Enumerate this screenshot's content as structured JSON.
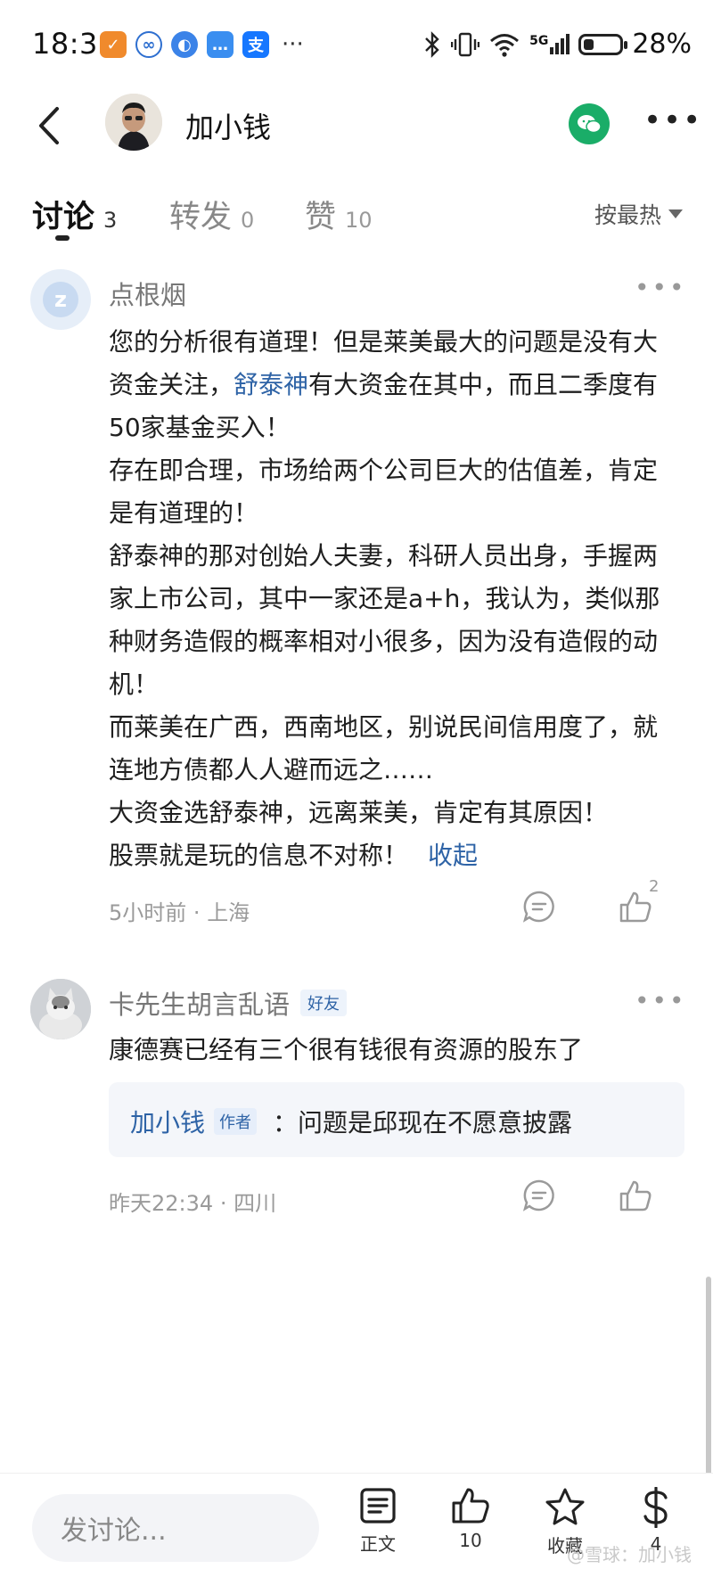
{
  "status_bar": {
    "time": "18:31",
    "network": "5G",
    "battery": "28%",
    "battery_level": 0.28
  },
  "header": {
    "title": "加小钱"
  },
  "tabs": [
    {
      "label": "讨论",
      "count": "3",
      "active": true
    },
    {
      "label": "转发",
      "count": "0",
      "active": false
    },
    {
      "label": "赞",
      "count": "10",
      "active": false
    }
  ],
  "sort": {
    "label": "按最热"
  },
  "comments": [
    {
      "user": "点根烟",
      "text_parts": {
        "p1_a": "您的分析很有道理！但是莱美最大的问题是没有大资金关注，",
        "p1_link": "舒泰神",
        "p1_b": "有大资金在其中，而且二季度有50家基金买入！",
        "p2": "存在即合理，市场给两个公司巨大的估值差，肯定是有道理的！",
        "p3": "舒泰神的那对创始人夫妻，科研人员出身，手握两家上市公司，其中一家还是a+h，我认为，类似那种财务造假的概率相对小很多，因为没有造假的动机！",
        "p4": "而莱美在广西，西南地区，别说民间信用度了，就连地方债都人人避而远之……",
        "p5": "大资金选舒泰神，远离莱美，肯定有其原因！",
        "p6": "股票就是玩的信息不对称！"
      },
      "collapse_label": "收起",
      "time": "5小时前",
      "location": "上海",
      "likes": "2"
    },
    {
      "user": "卡先生胡言乱语",
      "badge": "好友",
      "text": "康德赛已经有三个很有钱很有资源的股东了",
      "reply": {
        "name": "加小钱",
        "tag": "作者",
        "text": "：问题是邱现在不愿意披露"
      },
      "time": "昨天22:34",
      "location": "四川"
    }
  ],
  "bottom_bar": {
    "input_placeholder": "发讨论...",
    "article_label": "正文",
    "like_count": "10",
    "favorite_label": "收藏",
    "reward_count": "4"
  },
  "watermark": "@雪球：加小钱",
  "colors": {
    "link": "#2e63a6",
    "wechat": "#1aad68"
  }
}
